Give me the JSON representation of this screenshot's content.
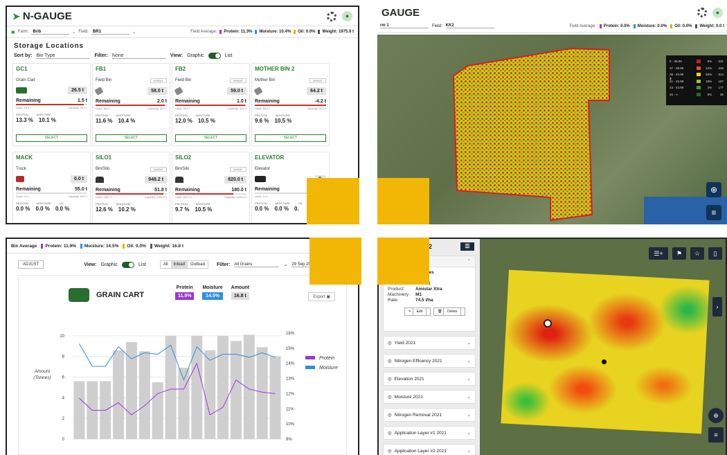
{
  "colors": {
    "brand_green": "#2a7d2e",
    "protein": "#9b35d6",
    "moisture": "#2d8fe0",
    "oil": "#e2b100",
    "alert_red": "#d42a2a",
    "accent_yellow": "#f2b705"
  },
  "storage": {
    "app_name": "N-GAUGE",
    "filters": {
      "farm_label": "Farm:",
      "farm_value": "Brib",
      "field_label": "Field:",
      "field_value": "BR1"
    },
    "field_average_label": "Field Average:",
    "stats": {
      "protein": "Protein: 11.3%",
      "moisture": "Moisture: 10.4%",
      "oil": "Oil: 0.0%",
      "weight": "Weight: 1975.9 t"
    },
    "title": "Storage Locations",
    "sort_label": "Sort by:",
    "sort_value": "Bin Type",
    "filter_label": "Filter:",
    "filter_value": "None",
    "view_label": "View:",
    "view_graphic": "Graphic",
    "view_list": "List",
    "remaining_label": "Remaining",
    "select_label": "SELECT",
    "mini_headers": [
      "PROTEIN",
      "MOISTURE",
      "OIL"
    ],
    "cards": [
      {
        "name": "GC1",
        "type": "Grain Cart",
        "tag": "",
        "amount": "26.5 t",
        "remaining": "1.5 t",
        "used": "Used: 26.5 t",
        "capacity": "Capacity: 28.0 t",
        "fill": 0.95,
        "protein": "13.3 %",
        "moisture": "10.1 %",
        "oil": "",
        "icon": "cart-icon",
        "select": true
      },
      {
        "name": "FB1",
        "type": "Field Bin",
        "tag": "WHEAT",
        "amount": "58.0 t",
        "remaining": "2.0 t",
        "used": "Used: 58.0 t",
        "capacity": "Capacity: 60.0 t",
        "fill": 0.97,
        "protein": "11.6 %",
        "moisture": "10.4 %",
        "oil": "",
        "icon": "field-bin-icon",
        "select": true
      },
      {
        "name": "FB2",
        "type": "Field Bin",
        "tag": "WHEAT",
        "amount": "59.0 t",
        "remaining": "1.0 t",
        "used": "Used: 59.0 t",
        "capacity": "Capacity: 60.0 t",
        "fill": 0.98,
        "protein": "12.0 %",
        "moisture": "10.5 %",
        "oil": "",
        "icon": "field-bin-icon",
        "select": true
      },
      {
        "name": "MOTHER BIN 2",
        "type": "Mother Bin",
        "tag": "WHEAT",
        "amount": "64.2 t",
        "remaining": "-4.2 t",
        "used": "Used: 64.2 t",
        "capacity": "Capacity: 60.0 t",
        "fill": 1.0,
        "protein": "9.6 %",
        "moisture": "10.5 %",
        "oil": "",
        "icon": "mother-bin-icon",
        "select": true
      },
      {
        "name": "MACK",
        "type": "Truck",
        "tag": "",
        "amount": "0.0 t",
        "remaining": "55.0 t",
        "used": "Used: 0.0 t",
        "capacity": "Capacity: 55.0 t",
        "fill": 0.0,
        "protein": "0.0 %",
        "moisture": "0.0 %",
        "oil": "0.0 %",
        "icon": "truck-icon",
        "select": false
      },
      {
        "name": "SILO1",
        "type": "Bin/Silo",
        "tag": "WHEAT",
        "amount": "948.2 t",
        "remaining": "51.8 t",
        "used": "Used: 948.2 t",
        "capacity": "Capacity: 1000.0 t",
        "fill": 0.95,
        "protein": "12.6 %",
        "moisture": "10.2 %",
        "oil": "",
        "icon": "silo-icon",
        "select": false
      },
      {
        "name": "SILO2",
        "type": "Bin/Silo",
        "tag": "WHEAT",
        "amount": "820.0 t",
        "remaining": "180.0 t",
        "used": "Used: 820.0 t",
        "capacity": "Capacity: 1000.0 t",
        "fill": 0.82,
        "protein": "9.7 %",
        "moisture": "10.5 %",
        "oil": "",
        "icon": "silo-icon",
        "select": false
      },
      {
        "name": "ELEVATOR",
        "type": "Elevator",
        "tag": "",
        "amount": "0.",
        "remaining": "9999",
        "used": "Used: 0.0 t",
        "capacity": "Capacity: 99",
        "fill": 0.0,
        "protein": "0.0 %",
        "moisture": "0.0 %",
        "oil": "0.",
        "icon": "elevator-icon",
        "select": false
      }
    ]
  },
  "map_top": {
    "app_name": "GAUGE",
    "farm_value": "rm 1",
    "field_label": "Field:",
    "field_value": "KK2",
    "field_average_label": "Field Average:",
    "stats": {
      "protein": "Protein: 0.0%",
      "moisture": "Moisture: 0.0%",
      "oil": "Oil: 0.0%",
      "weight": "Weight: 0.0 t"
    },
    "legend": [
      {
        "range": "0 - 36.99",
        "color": "#d42020",
        "pct": "5%",
        "count": "531"
      },
      {
        "range": "37 - 38.99",
        "color": "#e0532a",
        "pct": "24%",
        "count": "246"
      },
      {
        "range": "39 - 40.99",
        "color": "#f2d21a",
        "pct": "50%",
        "count": "514"
      },
      {
        "range": "41 - 42.99",
        "color": "#9cc22a",
        "pct": "18%",
        "count": "187"
      },
      {
        "range": "43 - 44.99",
        "color": "#3a9a3a",
        "pct": "2%",
        "count": "177"
      },
      {
        "range": "45 - ∞",
        "color": "#1e6e2e",
        "pct": "0%",
        "count": "35"
      }
    ]
  },
  "graincart": {
    "stats": {
      "average": "Bin Average",
      "protein": "Protein: 11.9%",
      "moisture": "Moisture: 14.5%",
      "oil": "Oil: 0.0%",
      "weight": "Weight: 16.8 t"
    },
    "adjust_label": "ADJUST",
    "view_label": "View:",
    "view_graphic": "Graphic",
    "view_list": "List",
    "seg": [
      "All",
      "Inload",
      "Outload"
    ],
    "filter_label": "Filter:",
    "filter_value": "All Grains",
    "date_value": "29 Sep 202",
    "machine_name": "GRAIN CART",
    "quality_headers": {
      "protein": "Protein",
      "moisture": "Moisture",
      "amount": "Amount"
    },
    "quality_values": {
      "protein": "11.9%",
      "moisture": "14.5%",
      "amount": "16.8 t"
    },
    "export_label": "Export"
  },
  "chart_data": {
    "type": "bar",
    "ylabel": "Amount\n(Tonnes)",
    "ylim": [
      0,
      11
    ],
    "yticks": [
      0,
      2,
      4,
      6,
      8,
      10
    ],
    "y2lim": [
      9,
      16.5
    ],
    "y2ticks": [
      "9%",
      "10%",
      "11%",
      "12%",
      "13%",
      "14%",
      "15%",
      "16%"
    ],
    "grid": true,
    "legend_position": "right",
    "values": [
      5.6,
      5.6,
      5.6,
      8.6,
      9.4,
      8.5,
      5.5,
      10.0,
      6.9,
      10.0,
      8.6,
      10.0,
      9.5,
      10.1,
      8.9,
      8.0
    ],
    "series": [
      {
        "name": "Protein",
        "color": "#9b35d6",
        "values": [
          11.7,
          10.9,
          10.9,
          11.4,
          10.6,
          11.2,
          12.0,
          12.3,
          12.3,
          14.0,
          10.6,
          11.1,
          12.9,
          12.3,
          12.1,
          12.0
        ]
      },
      {
        "name": "Moisture",
        "color": "#2d8fe0",
        "values": [
          15.3,
          13.8,
          13.8,
          15.1,
          14.3,
          14.7,
          14.6,
          15.2,
          12.9,
          15.1,
          14.2,
          14.6,
          14.6,
          14.4,
          14.7,
          14.4
        ]
      }
    ]
  },
  "paddock": {
    "title_fragment": "2",
    "details": [
      {
        "k": "",
        "v": "hectares"
      },
      {
        "k": "Crop:",
        "v": "Barley"
      },
      {
        "k": "Date:",
        "v": "6/10/21"
      },
      {
        "k": "Product:",
        "v": "Amistar Xtra"
      },
      {
        "k": "Machinery:",
        "v": "M1"
      },
      {
        "k": "Rate:",
        "v": "74.5 l/ha"
      }
    ],
    "edit_label": "Edit",
    "delete_label": "Delete",
    "layers": [
      "Yield 2021",
      "Nitrogen Efficency 2021",
      "Elevation 2021",
      "Moisture 2021",
      "Nitrogen Removal 2021",
      "Application Layer #1 2021",
      "Application Layer #2 2021"
    ]
  }
}
